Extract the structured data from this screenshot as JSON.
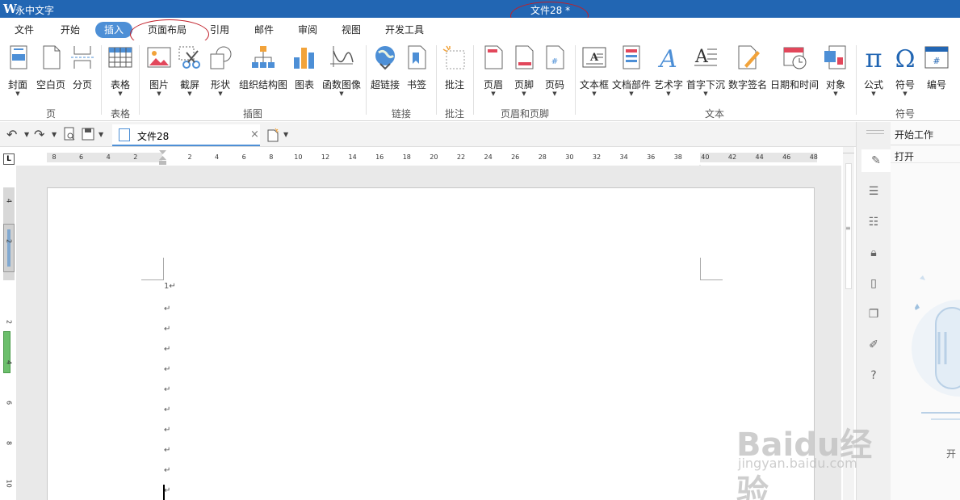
{
  "titlebar": {
    "app_name": "永中文字",
    "doc_title": "文件28 *",
    "bg_color": "#2266b3"
  },
  "menu": {
    "tabs": [
      {
        "label": "文件"
      },
      {
        "label": "开始"
      },
      {
        "label": "插入",
        "active": true
      },
      {
        "label": "页面布局"
      },
      {
        "label": "引用"
      },
      {
        "label": "邮件"
      },
      {
        "label": "审阅"
      },
      {
        "label": "视图"
      },
      {
        "label": "开发工具"
      }
    ],
    "active_color": "#4d8fd6"
  },
  "ribbon": {
    "buttons": [
      {
        "label": "封面",
        "icon": "cover-page-icon"
      },
      {
        "label": "空白页",
        "icon": "blank-page-icon"
      },
      {
        "label": "分页",
        "icon": "page-break-icon"
      },
      {
        "label": "表格",
        "icon": "table-icon"
      },
      {
        "label": "图片",
        "icon": "picture-icon"
      },
      {
        "label": "截屏",
        "icon": "screenshot-scissors-icon"
      },
      {
        "label": "形状",
        "icon": "shapes-icon"
      },
      {
        "label": "组织结构图",
        "icon": "org-chart-icon"
      },
      {
        "label": "图表",
        "icon": "bar-chart-icon"
      },
      {
        "label": "函数图像",
        "icon": "function-graph-icon"
      },
      {
        "label": "超链接",
        "icon": "hyperlink-globe-icon"
      },
      {
        "label": "书签",
        "icon": "bookmark-icon"
      },
      {
        "label": "批注",
        "icon": "comment-icon"
      },
      {
        "label": "页眉",
        "icon": "header-icon"
      },
      {
        "label": "页脚",
        "icon": "footer-icon"
      },
      {
        "label": "页码",
        "icon": "page-number-icon"
      },
      {
        "label": "文本框",
        "icon": "textbox-icon"
      },
      {
        "label": "文档部件",
        "icon": "document-parts-icon"
      },
      {
        "label": "艺术字",
        "icon": "wordart-icon"
      },
      {
        "label": "首字下沉",
        "icon": "drop-cap-icon"
      },
      {
        "label": "数字签名",
        "icon": "digital-signature-icon"
      },
      {
        "label": "日期和时间",
        "icon": "date-time-icon"
      },
      {
        "label": "对象",
        "icon": "object-icon"
      },
      {
        "label": "公式",
        "icon": "pi-formula-icon"
      },
      {
        "label": "符号",
        "icon": "omega-symbol-icon"
      },
      {
        "label": "编号",
        "icon": "numbering-icon"
      }
    ],
    "groups": [
      {
        "label": "页"
      },
      {
        "label": "表格"
      },
      {
        "label": "插图"
      },
      {
        "label": "链接"
      },
      {
        "label": "批注"
      },
      {
        "label": "页眉和页脚"
      },
      {
        "label": "文本"
      },
      {
        "label": "符号"
      }
    ],
    "formula_glyph": "π",
    "symbol_glyph": "Ω"
  },
  "quickbar": {
    "undo": "↶",
    "redo": "↷",
    "doc_tab": {
      "name": "文件28",
      "close": "×"
    }
  },
  "ruler": {
    "corner": "L",
    "h_ticks": [
      "8",
      "6",
      "4",
      "2",
      "2",
      "4",
      "6",
      "8",
      "10",
      "12",
      "14",
      "16",
      "18",
      "20",
      "22",
      "24",
      "26",
      "28",
      "30",
      "32",
      "34",
      "36",
      "38",
      "40",
      "42",
      "44",
      "46",
      "48"
    ],
    "v_ticks": [
      "4",
      "2",
      "2",
      "4",
      "6",
      "8",
      "10"
    ]
  },
  "document": {
    "first_line": "1↵",
    "paragraph_mark": "↵",
    "empty_paragraph_count": 10
  },
  "right_panel": {
    "items": [
      {
        "label": "开始工作"
      },
      {
        "label": "打开"
      }
    ]
  },
  "watermark": {
    "main": "Baidu经验",
    "sub": "jingyan.baidu.com"
  },
  "panel_cut_text": "开"
}
